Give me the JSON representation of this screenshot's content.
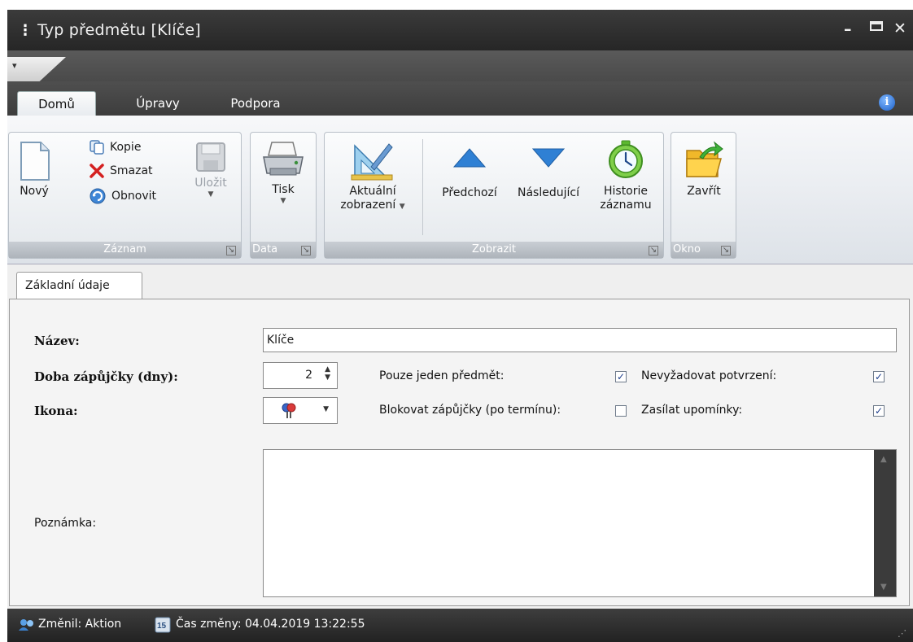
{
  "window": {
    "title": "Typ předmětu [Klíče]"
  },
  "ribbon": {
    "tabs": [
      "Domů",
      "Úpravy",
      "Podpora"
    ],
    "groups": {
      "record": {
        "caption": "Záznam",
        "new_label": "Nový",
        "copy_label": "Kopie",
        "delete_label": "Smazat",
        "refresh_label": "Obnovit",
        "save_label": "Uložit"
      },
      "data": {
        "caption": "Data",
        "print_label": "Tisk"
      },
      "view": {
        "caption": "Zobrazit",
        "current_view_label_1": "Aktuální",
        "current_view_label_2": "zobrazení",
        "previous_label": "Předchozí",
        "next_label": "Následující",
        "history_label_1": "Historie",
        "history_label_2": "záznamu"
      },
      "window": {
        "caption": "Okno",
        "close_label": "Zavřít"
      }
    }
  },
  "form": {
    "tab_label": "Základní údaje",
    "name_label": "Název:",
    "name_value": "Klíče",
    "loan_period_label": "Doba zápůjčky (dny):",
    "loan_period_value": "2",
    "icon_label": "Ikona:",
    "single_item_label": "Pouze jeden předmět:",
    "single_item_checked": true,
    "block_loans_label": "Blokovat zápůjčky (po termínu):",
    "block_loans_checked": false,
    "no_confirmation_label": "Nevyžadovat potvrzení:",
    "no_confirmation_checked": true,
    "send_reminders_label": "Zasílat upomínky:",
    "send_reminders_checked": true,
    "note_label": "Poznámka:",
    "note_value": ""
  },
  "status": {
    "changed_by": "Změnil: Aktion",
    "changed_time": "Čas změny: 04.04.2019 13:22:55"
  }
}
